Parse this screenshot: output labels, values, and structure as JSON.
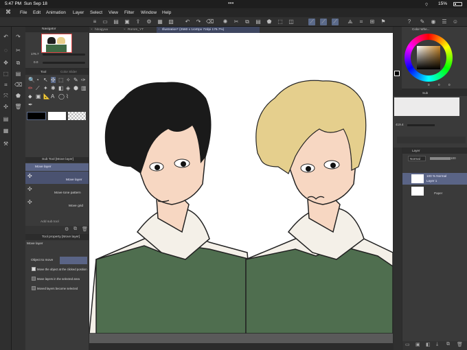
{
  "status": {
    "time": "5:47 PM",
    "date": "Sun Sep 18",
    "battery": "15%",
    "dots": "•••"
  },
  "menu": [
    "File",
    "Edit",
    "Animation",
    "Layer",
    "Select",
    "View",
    "Filter",
    "Window",
    "Help"
  ],
  "tabs": [
    {
      "label": "hitoigyuu",
      "active": false
    },
    {
      "label": "Rorom_YT",
      "active": false
    },
    {
      "label": "Illustration* (2560 x 1440px 72dpi 176.7%)",
      "active": true
    }
  ],
  "navigator": {
    "title": "Navigator",
    "zoom": "176.7",
    "angle": "0.0"
  },
  "tool_panel": {
    "tab1": "Tool",
    "tab2": "Color Slider"
  },
  "subtool": {
    "title": "Sub Tool [Move layer]",
    "items": [
      "Move layer",
      "Move layer",
      "Move tone pattern",
      "Move grid"
    ],
    "add_label": "Add sub tool"
  },
  "tool_property": {
    "title": "Tool property [Move layer]",
    "tool_name": "Move layer",
    "object_label": "Object to move",
    "options": [
      "Move the object at the clicked position",
      "Move layers in the selected area",
      "Moved layers become selected"
    ]
  },
  "color_wheel": {
    "title": "Color Whe...",
    "vals": [
      "0",
      "0",
      "0"
    ]
  },
  "sub_panel": {
    "title": "Sub",
    "value": "419.4"
  },
  "layer_panel": {
    "title": "Layer",
    "blend": "Normal",
    "opacity": "100",
    "layers": [
      {
        "line1": "100 % Normal",
        "line2": "Layer 1"
      },
      {
        "line1": "Paper",
        "line2": ""
      }
    ]
  }
}
